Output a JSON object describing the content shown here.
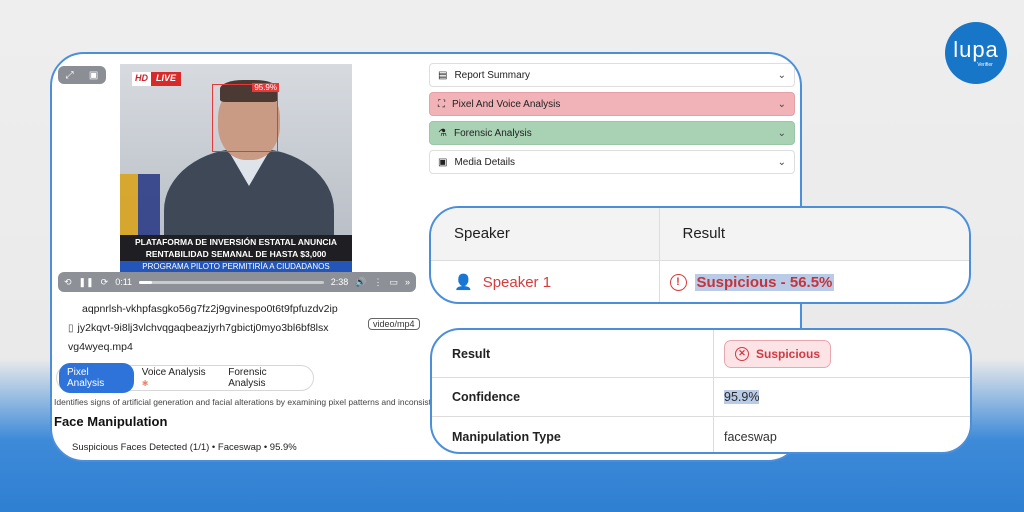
{
  "logo": {
    "brand": "lupa",
    "sub": "Verifier"
  },
  "video": {
    "hd": "HD",
    "live": "LIVE",
    "face_score": "95.9%",
    "caption_line1": "PLATAFORMA DE INVERSIÓN ESTATAL ANUNCIA",
    "caption_line2": "RENTABILIDAD SEMANAL DE HASTA $3,000",
    "caption_line3": "PROGRAMA PILOTO PERMITIRÍA A CIUDADANOS",
    "current_time": "0:11",
    "duration": "2:38",
    "progress": 0.07
  },
  "file": {
    "line1": "aqpnrlsh-vkhpfasgko56g7fz2j9gvinespo0t6t9fpfuzdv2ip",
    "line2": "jy2kqvt-9i8lj3vlchvqgaqbeazjyrh7gbictj0myo3bl6bf8lsx",
    "line3": "vg4wyeq.mp4",
    "mime": "video/mp4"
  },
  "tabs": [
    {
      "label": "Pixel Analysis"
    },
    {
      "label": "Voice Analysis"
    },
    {
      "label": "Forensic Analysis"
    }
  ],
  "analysis": {
    "description": "Identifies signs of artificial generation and facial alterations by examining pixel patterns and inconsistenc",
    "title": "Face Manipulation",
    "summary": "Suspicious Faces Detected (1/1) • Faceswap • 95.9%"
  },
  "accordions": [
    {
      "label": "Report Summary",
      "color": "#ffffff"
    },
    {
      "label": "Pixel And Voice Analysis",
      "color": "#f1b3b8"
    },
    {
      "label": "Forensic Analysis",
      "color": "#a9d2b4"
    },
    {
      "label": "Media Details",
      "color": "#ffffff"
    }
  ],
  "speaker_table": {
    "headers": [
      "Speaker",
      "Result"
    ],
    "row": {
      "speaker": "Speaker 1",
      "result": "Suspicious - 56.5%"
    }
  },
  "result_table": {
    "rows": [
      {
        "label": "Result",
        "value": "Suspicious"
      },
      {
        "label": "Confidence",
        "value": "95.9%"
      },
      {
        "label": "Manipulation Type",
        "value": "faceswap"
      }
    ]
  }
}
